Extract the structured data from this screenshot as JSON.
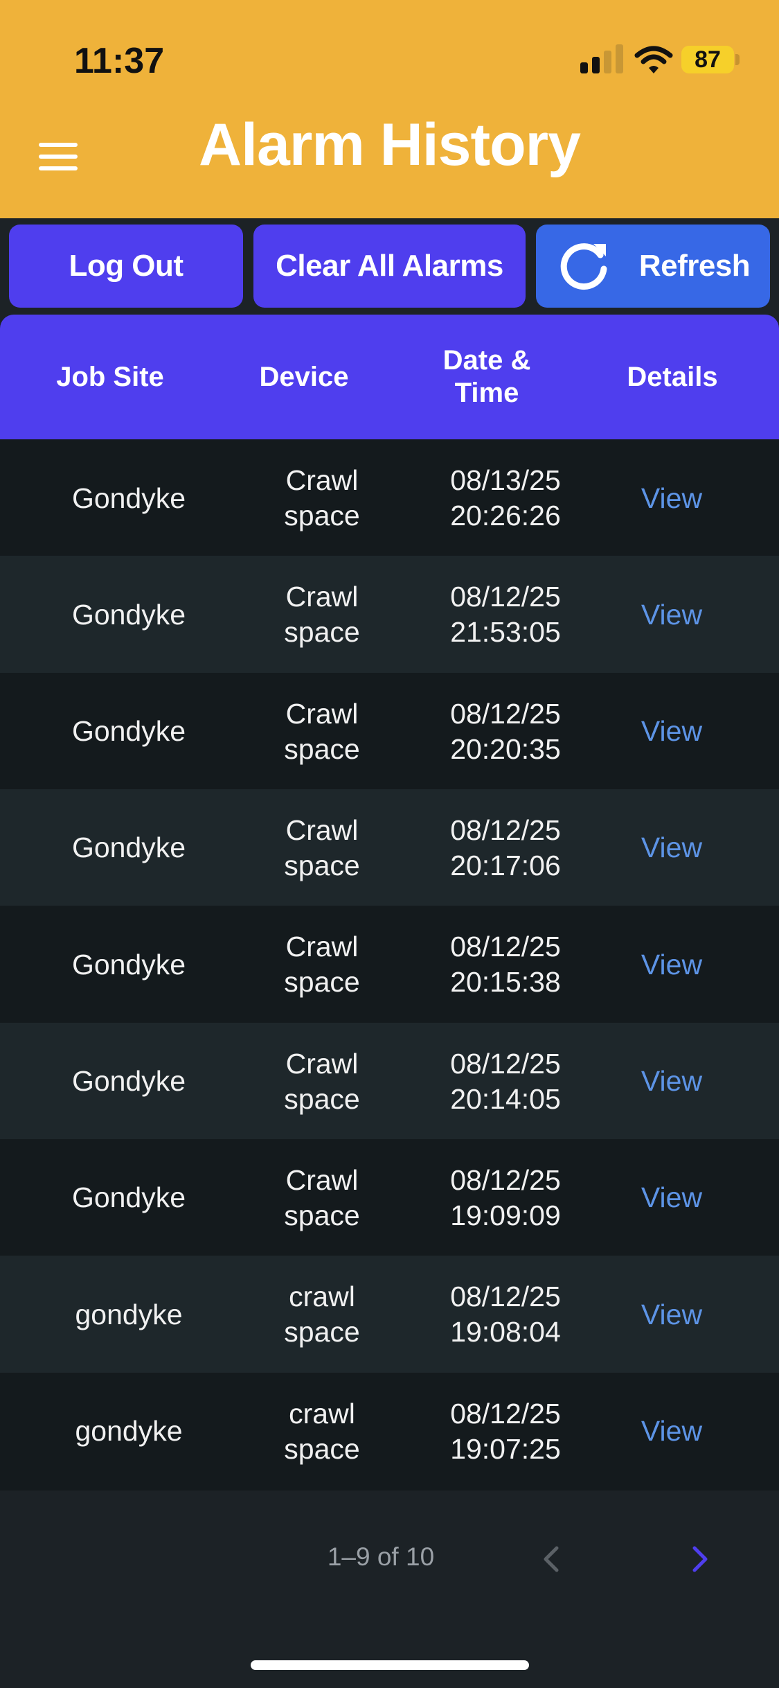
{
  "status_bar": {
    "time": "11:37",
    "battery": "87"
  },
  "header": {
    "title": "Alarm History",
    "bg_color": "#efb23a"
  },
  "actions": {
    "logout_label": "Log Out",
    "clear_label": "Clear All Alarms",
    "refresh_label": "Refresh"
  },
  "table": {
    "columns": [
      "Job Site",
      "Device",
      "Date &\nTime",
      "Details"
    ],
    "rows": [
      {
        "site": "Gondyke",
        "device": "Crawl\nspace",
        "datetime": "08/13/25\n20:26:26",
        "details": "View"
      },
      {
        "site": "Gondyke",
        "device": "Crawl\nspace",
        "datetime": "08/12/25\n21:53:05",
        "details": "View"
      },
      {
        "site": "Gondyke",
        "device": "Crawl\nspace",
        "datetime": "08/12/25\n20:20:35",
        "details": "View"
      },
      {
        "site": "Gondyke",
        "device": "Crawl\nspace",
        "datetime": "08/12/25\n20:17:06",
        "details": "View"
      },
      {
        "site": "Gondyke",
        "device": "Crawl\nspace",
        "datetime": "08/12/25\n20:15:38",
        "details": "View"
      },
      {
        "site": "Gondyke",
        "device": "Crawl\nspace",
        "datetime": "08/12/25\n20:14:05",
        "details": "View"
      },
      {
        "site": "Gondyke",
        "device": "Crawl\nspace",
        "datetime": "08/12/25\n19:09:09",
        "details": "View"
      },
      {
        "site": "gondyke",
        "device": "crawl\nspace",
        "datetime": "08/12/25\n19:08:04",
        "details": "View"
      },
      {
        "site": "gondyke",
        "device": "crawl\nspace",
        "datetime": "08/12/25\n19:07:25",
        "details": "View"
      }
    ]
  },
  "pagination": {
    "label": "1–9 of 10"
  },
  "colors": {
    "accent": "#4f3eee",
    "refresh": "#3768e6",
    "link": "#5d94e6",
    "row_dark": "#141a1d",
    "row_light": "#1e272b"
  }
}
